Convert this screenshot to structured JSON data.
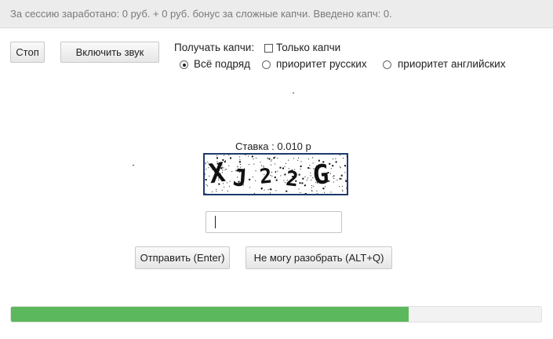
{
  "session": {
    "text": "За сессию заработано: 0 руб. + 0 руб. бонус за сложные капчи. Введено капч: 0."
  },
  "controls": {
    "stop_label": "Стоп",
    "sound_label": "Включить звук",
    "receive_label": "Получать капчи:",
    "only_captcha_label": "Только капчи",
    "only_captcha_checked": false,
    "modes": [
      {
        "label": "Всё подряд",
        "checked": true
      },
      {
        "label": "приоритет русских",
        "checked": false
      },
      {
        "label": "приоритет английских",
        "checked": false
      }
    ]
  },
  "captcha": {
    "bet_label": "Ставка : 0.010 р",
    "image_text": "XJ22G",
    "answer_value": ""
  },
  "actions": {
    "submit_label": "Отправить (Enter)",
    "cant_read_label": "Не могу разобрать  (ALT+Q)"
  },
  "progress": {
    "fraction": 0.75,
    "color": "#5cb85c"
  }
}
